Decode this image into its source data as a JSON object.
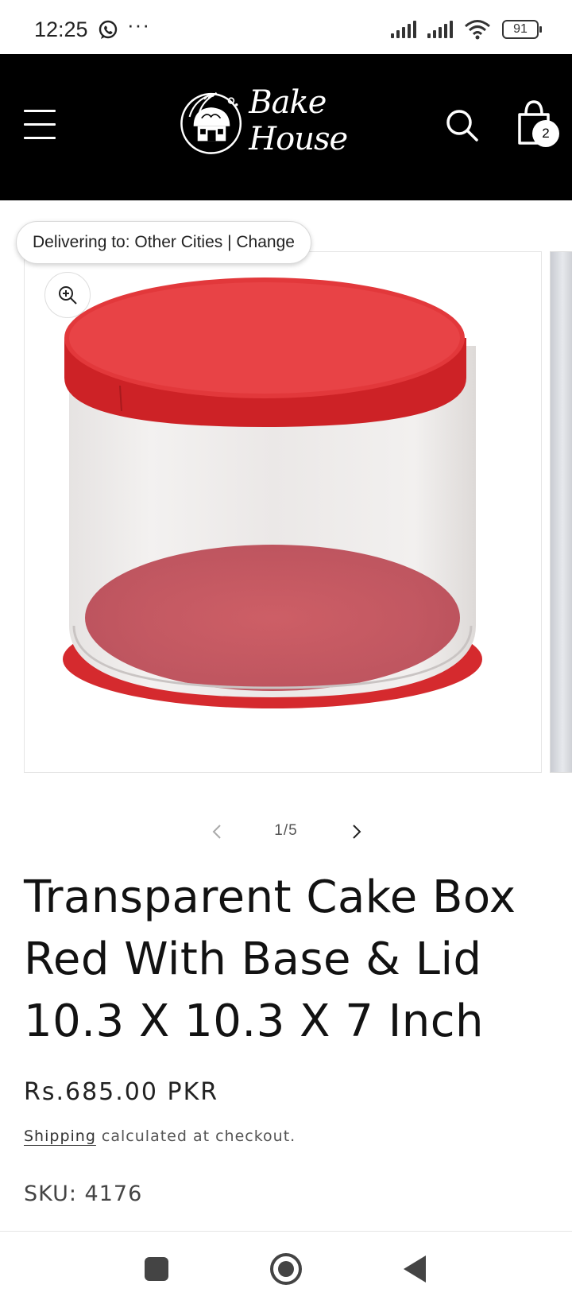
{
  "status_bar": {
    "time": "12:25",
    "dots": "···",
    "battery": "91"
  },
  "header": {
    "logo_text": "Bake House",
    "cart_count": "2"
  },
  "delivery": {
    "text": "Delivering to: Other Cities | Change"
  },
  "gallery": {
    "counter": "1/5"
  },
  "product": {
    "title": "Transparent Cake Box Red With Base & Lid 10.3 X 10.3 X 7 Inch",
    "price": "Rs.685.00 PKR",
    "shipping_link": "Shipping",
    "shipping_suffix": " calculated at checkout.",
    "sku": "SKU: 4176"
  },
  "colors": {
    "header_bg": "#000000",
    "box_red": "#d8282c"
  }
}
